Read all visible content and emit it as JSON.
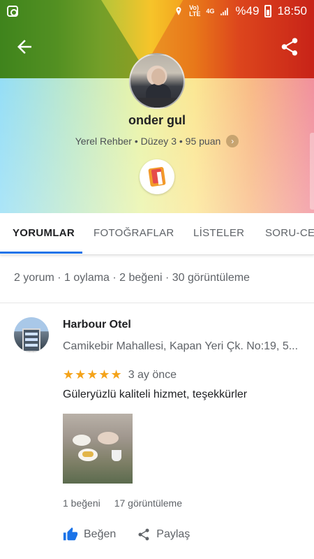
{
  "status_bar": {
    "battery_text": "%49",
    "time": "18:50",
    "network_line1": "Vo)",
    "network_line2": "LTE",
    "net_type": "4G"
  },
  "profile": {
    "name": "onder gul",
    "subtitle": "Yerel Rehber • Düzey 3 • 95 puan"
  },
  "tabs": [
    {
      "label": "YORUMLAR",
      "active": true
    },
    {
      "label": "FOTOĞRAFLAR",
      "active": false
    },
    {
      "label": "LİSTELER",
      "active": false
    },
    {
      "label": "SORU-CE",
      "active": false
    }
  ],
  "stats_text": "2 yorum · 1 oylama · 2 beğeni · 30 görüntüleme",
  "review": {
    "place_name": "Harbour Otel",
    "address": "Camikebir Mahallesi, Kapan Yeri Çk. No:19, 5...",
    "stars_text": "★★★★★",
    "rating": 5,
    "time_ago": "3 ay önce",
    "text": "Güleryüzlü kaliteli  hizmet, teşekkürler",
    "likes_text": "1 beğeni",
    "views_text": "17 görüntüleme",
    "like_label": "Beğen",
    "share_label": "Paylaş"
  },
  "colors": {
    "accent": "#1a73e8",
    "star": "#f4a31a",
    "text_primary": "#202124",
    "text_secondary": "#5f6368"
  },
  "icons": {
    "back": "arrow-left-icon",
    "share": "share-icon",
    "like": "thumb-up-icon",
    "chevron": "chevron-right-icon"
  }
}
